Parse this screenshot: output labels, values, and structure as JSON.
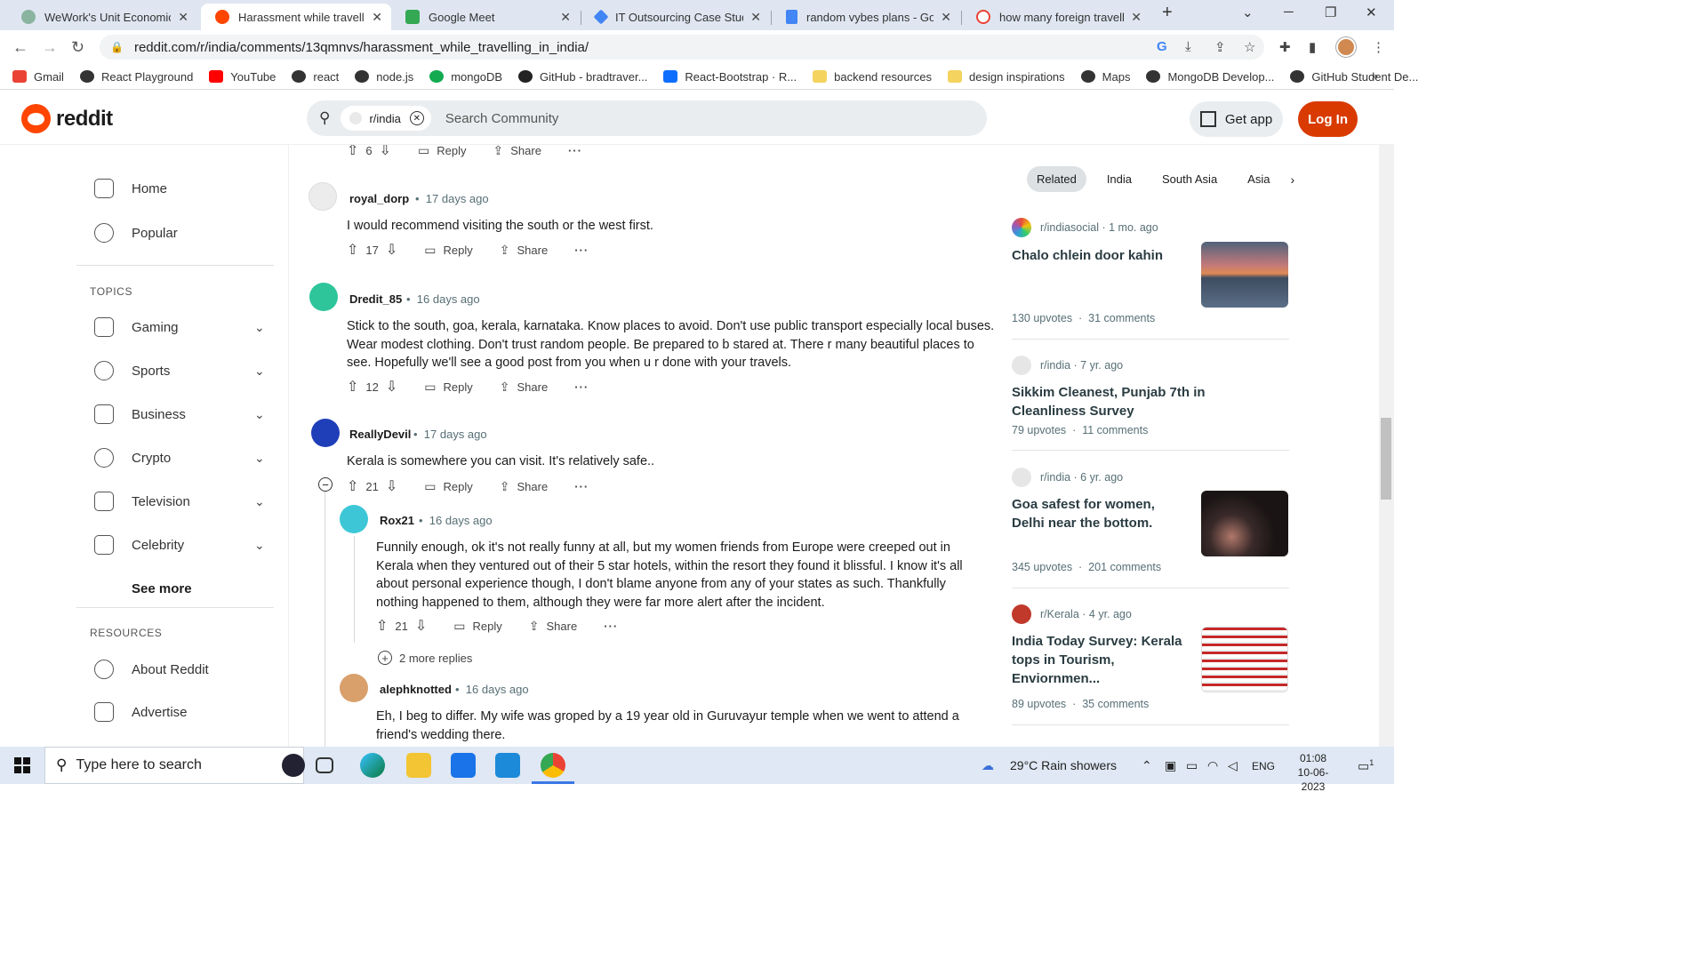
{
  "browser": {
    "tabs": [
      {
        "title": "WeWork's Unit Economics",
        "active": false,
        "color": "#8ab4a0"
      },
      {
        "title": "Harassment while travelling",
        "active": true,
        "color": "#ff4500"
      },
      {
        "title": "Google Meet",
        "active": false,
        "color": "#34a853"
      },
      {
        "title": "IT Outsourcing Case Studies",
        "active": false,
        "color": "#4285f4"
      },
      {
        "title": "random vybes plans - Goog",
        "active": false,
        "color": "#4285f4"
      },
      {
        "title": "how many foreign travellers",
        "active": false,
        "color": "#ea4335"
      }
    ],
    "url": "reddit.com/r/india/comments/13qmnvs/harassment_while_travelling_in_india/",
    "bookmarks": [
      {
        "label": "Gmail",
        "color": "#ea4335"
      },
      {
        "label": "React Playground",
        "color": "#333"
      },
      {
        "label": "YouTube",
        "color": "#ff0000"
      },
      {
        "label": "react",
        "color": "#333"
      },
      {
        "label": "node.js",
        "color": "#333"
      },
      {
        "label": "mongoDB",
        "color": "#13aa52"
      },
      {
        "label": "GitHub - bradtraver...",
        "color": "#222"
      },
      {
        "label": "React-Bootstrap · R...",
        "color": "#0d6efd"
      },
      {
        "label": "backend resources",
        "color": "#f4d35e"
      },
      {
        "label": "design inspirations",
        "color": "#f4d35e"
      },
      {
        "label": "Maps",
        "color": "#333"
      },
      {
        "label": "MongoDB Develop...",
        "color": "#333"
      },
      {
        "label": "GitHub Student De...",
        "color": "#333"
      }
    ],
    "bookmarks_more": "»"
  },
  "reddit": {
    "logo_text": "reddit",
    "search_chip": "r/india",
    "search_placeholder": "Search Community",
    "get_app": "Get app",
    "login": "Log In"
  },
  "left_nav": {
    "main": [
      {
        "label": "Home",
        "icon": "home-icon"
      },
      {
        "label": "Popular",
        "icon": "popular-icon"
      }
    ],
    "topics_heading": "TOPICS",
    "topics": [
      {
        "label": "Gaming",
        "icon": "gaming-icon"
      },
      {
        "label": "Sports",
        "icon": "sports-icon"
      },
      {
        "label": "Business",
        "icon": "business-icon"
      },
      {
        "label": "Crypto",
        "icon": "crypto-icon"
      },
      {
        "label": "Television",
        "icon": "television-icon"
      },
      {
        "label": "Celebrity",
        "icon": "celebrity-icon"
      }
    ],
    "see_more": "See more",
    "resources_heading": "RESOURCES",
    "resources": [
      {
        "label": "About Reddit",
        "icon": "about-icon"
      },
      {
        "label": "Advertise",
        "icon": "advertise-icon"
      }
    ]
  },
  "comments": {
    "top_action_score": "6",
    "reply_label": "Reply",
    "share_label": "Share",
    "more_label": "···",
    "items": [
      {
        "author": "royal_dorp",
        "time": "17 days ago",
        "body": "I would recommend visiting the south or the west first.",
        "score": "17",
        "avatar_color": "#ececec"
      },
      {
        "author": "Dredit_85",
        "time": "16 days ago",
        "body": "Stick to the south, goa, kerala, karnataka. Know places to avoid. Don't use public transport especially local buses. Wear modest clothing. Don't trust random people. Be prepared to b stared at. There r many beautiful places to see. Hopefully we'll see a good post from you when u r done with your travels.",
        "score": "12",
        "avatar_color": "#2ec59b"
      },
      {
        "author": "ReallyDevil",
        "time": "17 days ago",
        "body": "Kerala is somewhere you can visit. It's relatively safe..",
        "score": "21",
        "avatar_color": "#1e3fb8"
      },
      {
        "author": "Rox21",
        "time": "16 days ago",
        "body": "Funnily enough, ok it's not really funny at all, but my women friends from Europe were creeped out in Kerala when they ventured out of their 5 star hotels, within the resort they found it blissful. I know it's all about personal experience though, I don't blame anyone from any of your states as such. Thankfully nothing happened to them, although they were far more alert after the incident.",
        "score": "21",
        "avatar_color": "#3dc7d6"
      },
      {
        "author": "alephknotted",
        "time": "16 days ago",
        "body": "Eh, I beg to differ. My wife was groped by a 19 year old in Guruvayur temple when we went to attend a friend's wedding there.",
        "avatar_color": "#d9a06c"
      }
    ],
    "more_replies": "2 more replies"
  },
  "related": {
    "tabs": [
      "Related",
      "India",
      "South Asia",
      "Asia"
    ],
    "active_tab": "Related",
    "cards": [
      {
        "sub": "r/indiasocial",
        "age": "1 mo. ago",
        "title": "Chalo chlein door kahin",
        "upvotes": "130 upvotes",
        "comments": "31 comments",
        "thumb": "sunset-beach",
        "icon_color": "#e8a33a"
      },
      {
        "sub": "r/india",
        "age": "7 yr. ago",
        "title": "Sikkim Cleanest, Punjab 7th in Cleanliness Survey",
        "upvotes": "79 upvotes",
        "comments": "11 comments",
        "icon_color": "#d8d8d8"
      },
      {
        "sub": "r/india",
        "age": "6 yr. ago",
        "title": "Goa safest for women, Delhi near the bottom.",
        "upvotes": "345 upvotes",
        "comments": "201 comments",
        "thumb": "protest-photo",
        "icon_color": "#d8d8d8"
      },
      {
        "sub": "r/Kerala",
        "age": "4 yr. ago",
        "title": "India Today Survey: Kerala tops in Tourism, Enviornmen...",
        "upvotes": "89 upvotes",
        "comments": "35 comments",
        "thumb": "survey-table",
        "icon_color": "#c0392b"
      }
    ]
  },
  "taskbar": {
    "search_placeholder": "Type here to search",
    "weather": "29°C  Rain showers",
    "lang": "ENG",
    "time": "01:08",
    "date": "10-06-2023",
    "notif_count": "1"
  }
}
